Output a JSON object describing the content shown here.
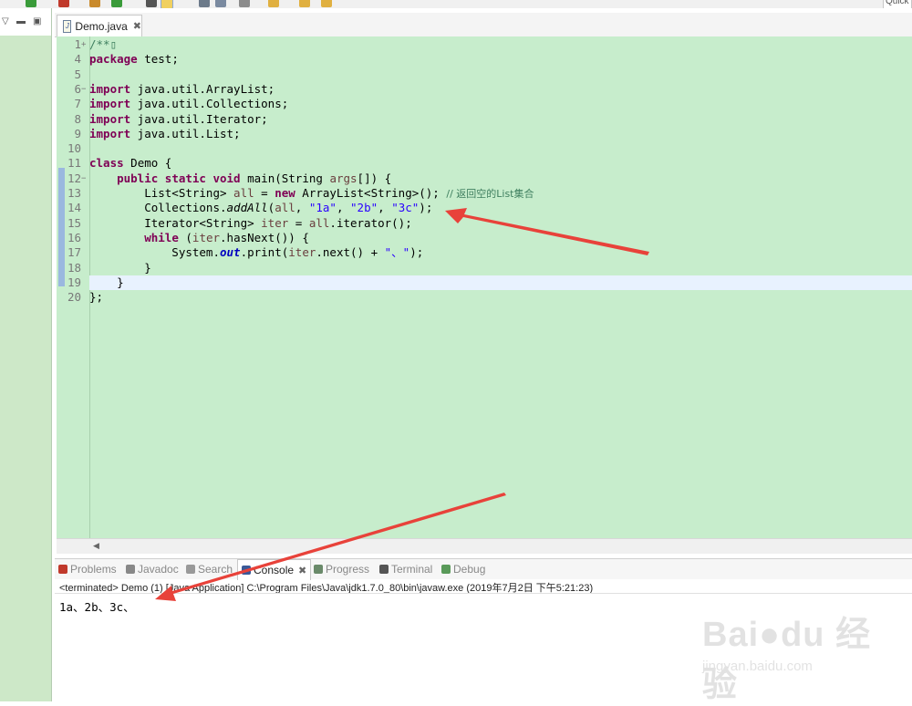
{
  "toolbar": {
    "quick_access": "Quick"
  },
  "editor": {
    "tab_label": "Demo.java",
    "lines": [
      {
        "n": "1",
        "fold": "+",
        "parts": [
          {
            "t": "/**",
            "c": "cm"
          },
          {
            "t": "▯",
            "c": "cm"
          }
        ]
      },
      {
        "n": "4",
        "parts": [
          {
            "t": "package",
            "c": "kw"
          },
          {
            "t": " test;",
            "c": ""
          }
        ]
      },
      {
        "n": "5",
        "parts": []
      },
      {
        "n": "6",
        "fold": "−",
        "parts": [
          {
            "t": "import",
            "c": "kw"
          },
          {
            "t": " java.util.ArrayList;",
            "c": ""
          }
        ]
      },
      {
        "n": "7",
        "parts": [
          {
            "t": "import",
            "c": "kw"
          },
          {
            "t": " java.util.Collections;",
            "c": ""
          }
        ]
      },
      {
        "n": "8",
        "parts": [
          {
            "t": "import",
            "c": "kw"
          },
          {
            "t": " java.util.Iterator;",
            "c": ""
          }
        ]
      },
      {
        "n": "9",
        "parts": [
          {
            "t": "import",
            "c": "kw"
          },
          {
            "t": " java.util.List;",
            "c": ""
          }
        ]
      },
      {
        "n": "10",
        "parts": []
      },
      {
        "n": "11",
        "parts": [
          {
            "t": "class",
            "c": "kw"
          },
          {
            "t": " Demo {",
            "c": ""
          }
        ]
      },
      {
        "n": "12",
        "fold": "−",
        "parts": [
          {
            "t": "    ",
            "c": ""
          },
          {
            "t": "public",
            "c": "kw"
          },
          {
            "t": " ",
            "c": ""
          },
          {
            "t": "static",
            "c": "kw"
          },
          {
            "t": " ",
            "c": ""
          },
          {
            "t": "void",
            "c": "kw"
          },
          {
            "t": " main(String ",
            "c": ""
          },
          {
            "t": "args",
            "c": "var"
          },
          {
            "t": "[]) {",
            "c": ""
          }
        ]
      },
      {
        "n": "13",
        "parts": [
          {
            "t": "        List<String> ",
            "c": ""
          },
          {
            "t": "all",
            "c": "var"
          },
          {
            "t": " = ",
            "c": ""
          },
          {
            "t": "new",
            "c": "kw"
          },
          {
            "t": " ArrayList<String>(); ",
            "c": ""
          },
          {
            "t": "// 返回空的List集合",
            "c": "cm"
          }
        ]
      },
      {
        "n": "14",
        "parts": [
          {
            "t": "        Collections.",
            "c": ""
          },
          {
            "t": "addAll",
            "c": "it"
          },
          {
            "t": "(",
            "c": ""
          },
          {
            "t": "all",
            "c": "var"
          },
          {
            "t": ", ",
            "c": ""
          },
          {
            "t": "\"1a\"",
            "c": "str"
          },
          {
            "t": ", ",
            "c": ""
          },
          {
            "t": "\"2b\"",
            "c": "str"
          },
          {
            "t": ", ",
            "c": ""
          },
          {
            "t": "\"3c\"",
            "c": "str"
          },
          {
            "t": ");",
            "c": ""
          }
        ]
      },
      {
        "n": "15",
        "parts": [
          {
            "t": "        Iterator<String> ",
            "c": ""
          },
          {
            "t": "iter",
            "c": "var"
          },
          {
            "t": " = ",
            "c": ""
          },
          {
            "t": "all",
            "c": "var"
          },
          {
            "t": ".iterator();",
            "c": ""
          }
        ]
      },
      {
        "n": "16",
        "parts": [
          {
            "t": "        ",
            "c": ""
          },
          {
            "t": "while",
            "c": "kw"
          },
          {
            "t": " (",
            "c": ""
          },
          {
            "t": "iter",
            "c": "var"
          },
          {
            "t": ".hasNext()) {",
            "c": ""
          }
        ]
      },
      {
        "n": "17",
        "parts": [
          {
            "t": "            System.",
            "c": ""
          },
          {
            "t": "out",
            "c": "fld"
          },
          {
            "t": ".print(",
            "c": ""
          },
          {
            "t": "iter",
            "c": "var"
          },
          {
            "t": ".next() + ",
            "c": ""
          },
          {
            "t": "\"、\"",
            "c": "str"
          },
          {
            "t": ");",
            "c": ""
          }
        ]
      },
      {
        "n": "18",
        "parts": [
          {
            "t": "        }",
            "c": ""
          }
        ]
      },
      {
        "n": "19",
        "parts": [
          {
            "t": "    }",
            "c": ""
          }
        ]
      },
      {
        "n": "20",
        "parts": [
          {
            "t": "};",
            "c": ""
          }
        ]
      }
    ]
  },
  "console": {
    "tabs": [
      {
        "label": "Problems",
        "icon": "problems-icon"
      },
      {
        "label": "Javadoc",
        "icon": "at-icon"
      },
      {
        "label": "Search",
        "icon": "flashlight-icon"
      },
      {
        "label": "Console",
        "icon": "console-icon",
        "active": true
      },
      {
        "label": "Progress",
        "icon": "progress-icon"
      },
      {
        "label": "Terminal",
        "icon": "terminal-icon"
      },
      {
        "label": "Debug",
        "icon": "bug-icon"
      }
    ],
    "status": "<terminated> Demo (1) [Java Application] C:\\Program Files\\Java\\jdk1.7.0_80\\bin\\javaw.exe (2019年7月2日 下午5:21:23)",
    "output": "1a、2b、3c、"
  },
  "watermark": {
    "brand": "Bai●du 经验",
    "url": "jingyan.baidu.com"
  },
  "colors": {
    "editor_bg": "#c7edcc",
    "keyword": "#7f0055",
    "string": "#2a00ff",
    "comment": "#3f7f5f",
    "annotation_arrow": "#e8423a"
  }
}
